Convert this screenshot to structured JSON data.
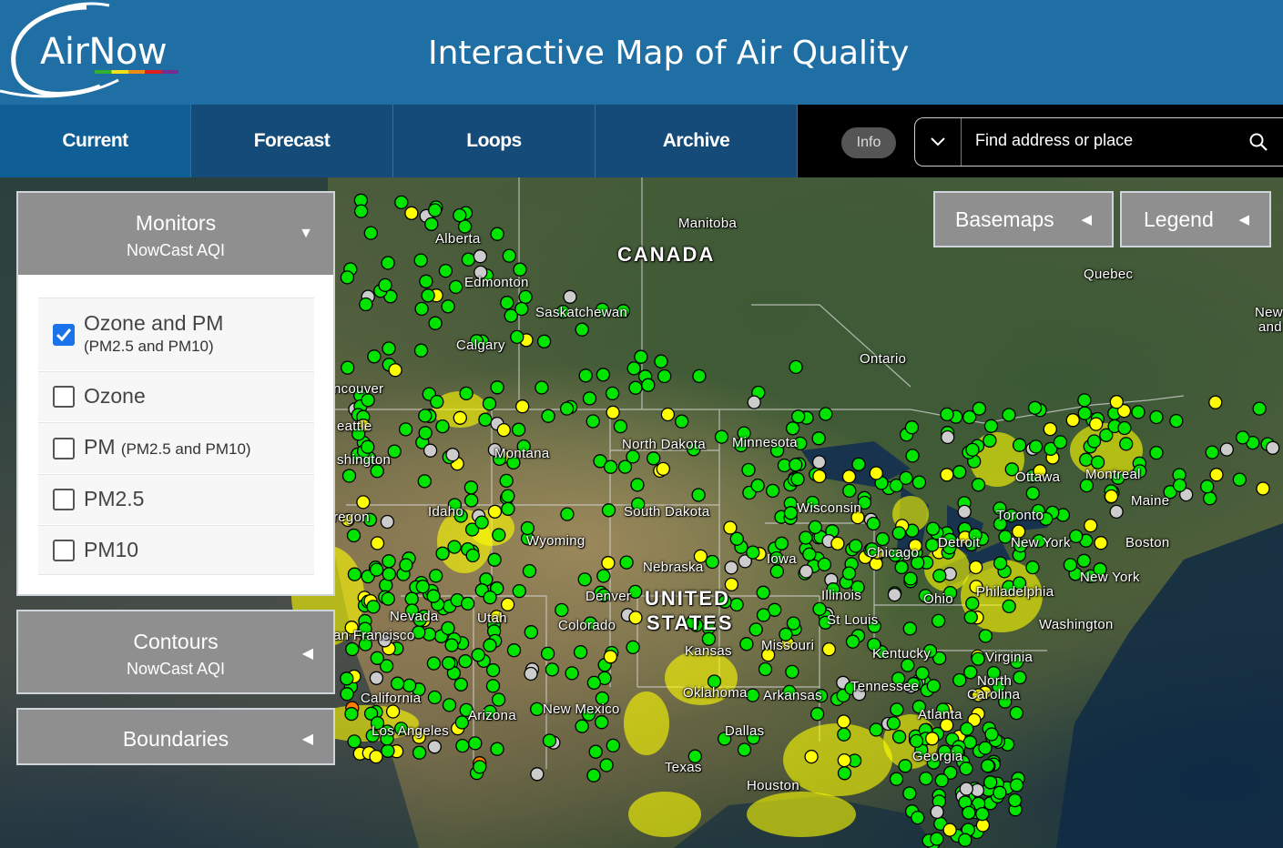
{
  "header": {
    "logo_text": "AirNow",
    "title": "Interactive Map of Air Quality"
  },
  "nav": {
    "tabs": [
      {
        "label": "Current",
        "active": true
      },
      {
        "label": "Forecast",
        "active": false
      },
      {
        "label": "Loops",
        "active": false
      },
      {
        "label": "Archive",
        "active": false
      }
    ],
    "info_label": "Info",
    "search_placeholder": "Find address or place"
  },
  "monitors_panel": {
    "title": "Monitors",
    "subtitle": "NowCast AQI",
    "options": [
      {
        "label": "Ozone and PM",
        "sub": "(PM2.5 and PM10)",
        "checked": true
      },
      {
        "label": "Ozone",
        "sub": "",
        "checked": false
      },
      {
        "label": "PM",
        "sub": "(PM2.5 and PM10)",
        "checked": false
      },
      {
        "label": "PM2.5",
        "sub": "",
        "checked": false
      },
      {
        "label": "PM10",
        "sub": "",
        "checked": false
      }
    ]
  },
  "contours_panel": {
    "title": "Contours",
    "subtitle": "NowCast AQI"
  },
  "boundaries_panel": {
    "title": "Boundaries"
  },
  "map_buttons": {
    "basemaps": "Basemaps",
    "legend": "Legend"
  },
  "map_labels": {
    "manitoba": "Manitoba",
    "alberta": "Alberta",
    "canada": "CANADA",
    "quebec": "Quebec",
    "edmonton": "Edmonton",
    "saskatchewan": "Saskatchewan",
    "calgary": "Calgary",
    "ontario": "Ontario",
    "vancouver": "ncouver",
    "seattle": "eattle",
    "washington_state": "shington",
    "oregon": "regon",
    "montana": "Montana",
    "north_dakota": "North Dakota",
    "minnesota": "Minnesota",
    "idaho": "Idaho",
    "south_dakota": "South Dakota",
    "wisconsin": "Wisconsin",
    "wyoming": "Wyoming",
    "nebraska": "Nebraska",
    "iowa": "Iowa",
    "chicago": "Chicago",
    "detroit": "Detroit",
    "ottawa": "Ottawa",
    "montreal": "Montreal",
    "toronto": "Toronto",
    "maine": "Maine",
    "boston": "Boston",
    "new_york_state": "New York",
    "new_york_city": "New York",
    "new_brunswick": "New",
    "new_brunswick2": "and",
    "nevada": "Nevada",
    "utah": "Utah",
    "denver": "Denver",
    "colorado": "Colorado",
    "united": "UNITED",
    "states": "STATES",
    "illinois": "Illinois",
    "ohio": "Ohio",
    "philadelphia": "Philadelphia",
    "san_francisco": "an Francisco",
    "kansas": "Kansas",
    "missouri": "Missouri",
    "st_louis": "St Louis",
    "kentucky": "Kentucky",
    "washington_dc": "Washington",
    "virginia": "Virginia",
    "california": "California",
    "oklahoma": "Oklahoma",
    "arkansas": "Arkansas",
    "tennessee": "Tennessee",
    "north": "North",
    "carolina": "Carolina",
    "atlanta": "Atlanta",
    "los_angeles": "Los Angeles",
    "arizona": "Arizona",
    "new_mexico": "New Mexico",
    "dallas": "Dallas",
    "georgia": "Georgia",
    "texas": "Texas",
    "houston": "Houston"
  },
  "aqi_colors": {
    "good": "#00e400",
    "moderate": "#ffff00",
    "usg": "#ff7e00",
    "no_data": "#cccccc"
  }
}
